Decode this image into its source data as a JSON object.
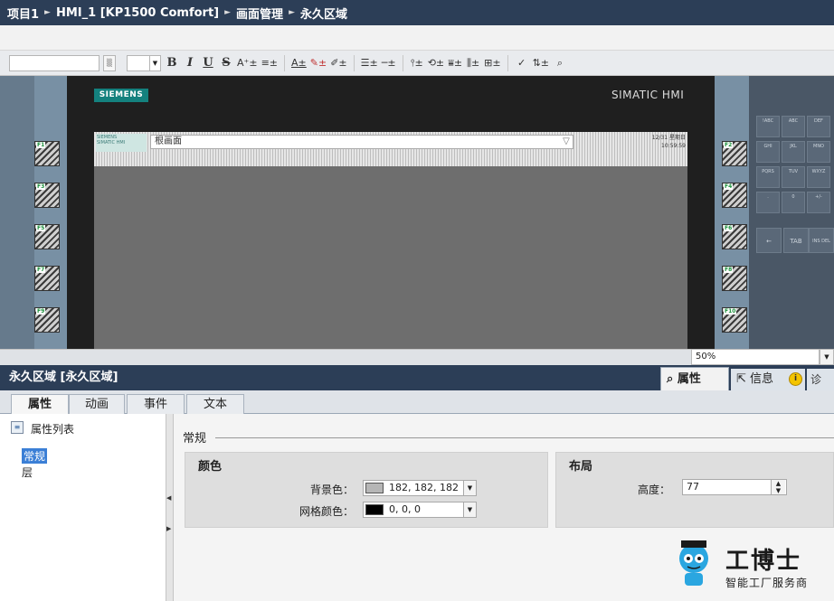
{
  "breadcrumb": {
    "project": "项目1",
    "device": "HMI_1 [KP1500 Comfort]",
    "folder": "画面管理",
    "item": "永久区域"
  },
  "toolbar": {
    "bold": "B",
    "italic": "I",
    "underline": "U",
    "strike": "S",
    "fontsize": "A⁺±",
    "align": "≡±",
    "textcolor": "A±",
    "fillcolor": "✎±",
    "linecolor": "✐±",
    "lines": "☰±",
    "dash": "─±"
  },
  "hmi": {
    "brand": "SIEMENS",
    "model": "SIMATIC HMI",
    "root_screen": "根画面",
    "clock": "12/31 星期日\n10:59:59",
    "left_keys": [
      "F1",
      "F3",
      "F5",
      "F7",
      "F9"
    ],
    "right_keys": [
      "F2",
      "F4",
      "F6",
      "F8",
      "F10"
    ],
    "keypad_keys": [
      [
        "!ABC",
        "ABC",
        "DEF"
      ],
      [
        "GHI",
        "JKL",
        "MNO"
      ],
      [
        "PQRS",
        "TUV",
        "WXYZ"
      ],
      [
        ".",
        "0",
        "+/-"
      ]
    ],
    "keypad_bottom": [
      "←",
      "TAB",
      "INS DEL"
    ],
    "zoom": "50%"
  },
  "inspector": {
    "title": "永久区域 [永久区域]",
    "tab_properties": "属性",
    "tab_info": "信息",
    "tab_info_icon": "i",
    "tab_diag": "诊",
    "subtabs": [
      "属性",
      "动画",
      "事件",
      "文本"
    ],
    "property_list": "属性列表",
    "nav_general": "常规",
    "nav_layer": "层",
    "section": "常规",
    "color_group": "颜色",
    "bg_label": "背景色：",
    "bg_value": "182, 182, 182",
    "bg_swatch": "#b6b6b6",
    "grid_label": "网格颜色：",
    "grid_value": "0, 0, 0",
    "grid_swatch": "#000000",
    "layout_group": "布局",
    "height_label": "高度：",
    "height_value": "77"
  },
  "watermark": {
    "title": "工博士",
    "subtitle": "智能工厂服务商"
  },
  "colors": {
    "titlebar": "#2c3e57",
    "siemens": "#14817e",
    "selection": "#3b7fd6"
  }
}
